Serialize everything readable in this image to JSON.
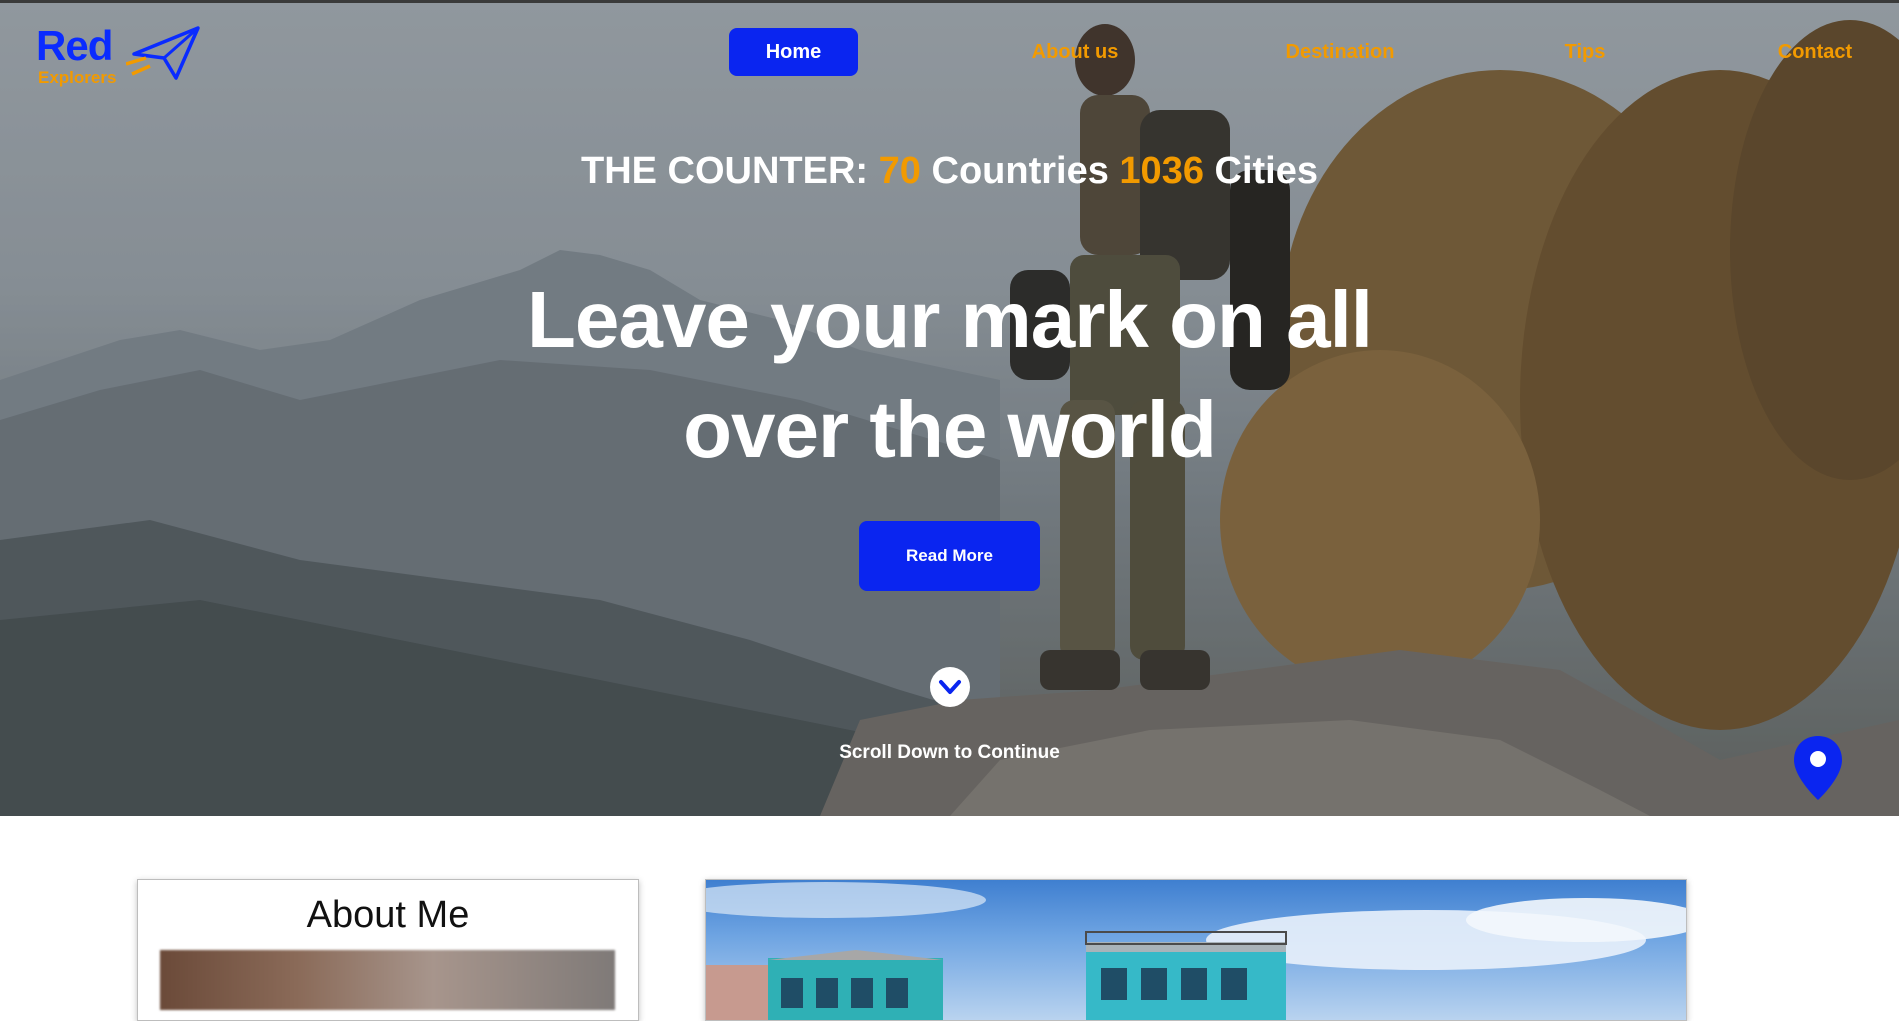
{
  "logo": {
    "word": "Red",
    "sub": "Explorers",
    "icon": "paper-plane-icon",
    "color": "#0a2bff",
    "accent": "#f29a00"
  },
  "nav": {
    "home": "Home",
    "about": "About us",
    "destination": "Destination",
    "tips": "Tips",
    "contact": "Contact"
  },
  "hero": {
    "counter_prefix": "THE COUNTER:",
    "countries_num": "70",
    "countries_label": "Countries",
    "cities_num": "1036",
    "cities_label": "Cities",
    "headline_line1": "Leave your mark on all",
    "headline_line2": "over the world",
    "cta": "Read More",
    "scroll_text": "Scroll Down to Continue",
    "scroll_icon": "chevron-down-icon",
    "pin_icon": "map-pin-icon"
  },
  "about": {
    "title": "About Me"
  },
  "colors": {
    "primary": "#0a25f0",
    "accent": "#f29a00"
  }
}
